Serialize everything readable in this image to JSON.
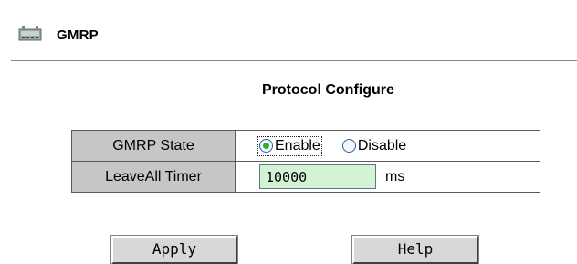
{
  "header": {
    "title": "GMRP",
    "icon": "gmrp-icon"
  },
  "section_title": "Protocol Configure",
  "form": {
    "state": {
      "label": "GMRP State",
      "options": [
        "Enable",
        "Disable"
      ],
      "selected": "Enable"
    },
    "leaveall": {
      "label": "LeaveAll Timer",
      "value": "10000",
      "unit": "ms"
    }
  },
  "buttons": {
    "apply": "Apply",
    "help": "Help"
  },
  "colors": {
    "label_bg": "#c6c6c6",
    "input_bg": "#d4f2d4",
    "radio_dot": "#2bb02b",
    "button_bg": "#d8d8d8"
  }
}
